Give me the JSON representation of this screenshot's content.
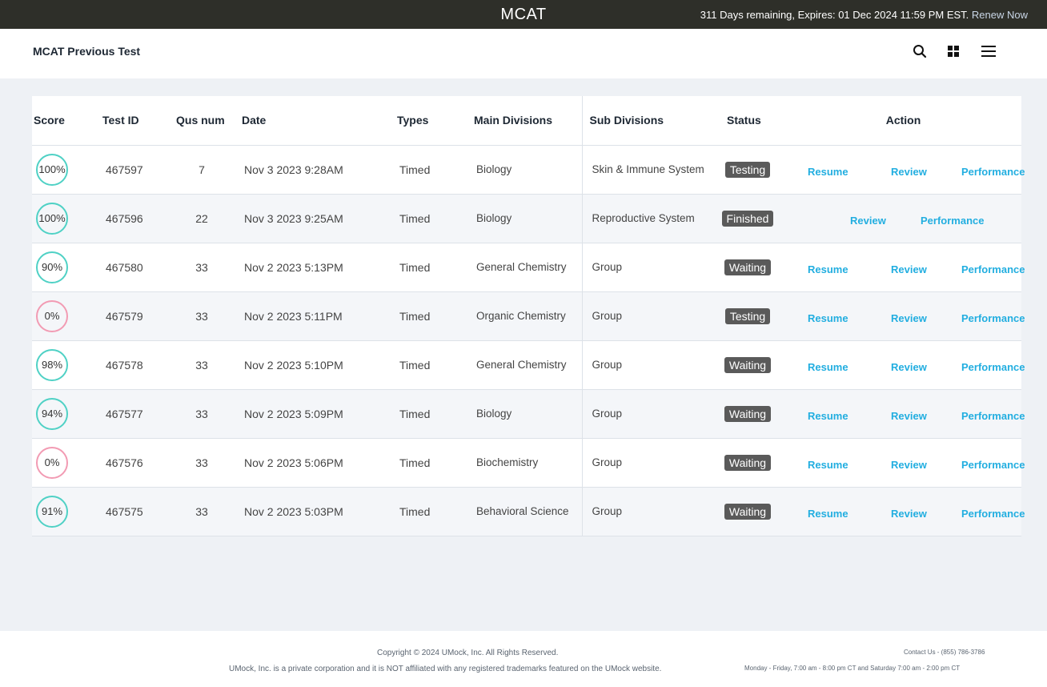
{
  "topbar": {
    "title": "MCAT",
    "subscription": "311 Days remaining, Expires: 01 Dec 2024 11:59 PM EST.",
    "renew_label": "Renew Now"
  },
  "header": {
    "page_title": "MCAT Previous Test",
    "icons": [
      "search-icon",
      "grid-icon",
      "menu-icon"
    ]
  },
  "table": {
    "columns": [
      "Score",
      "Test ID",
      "Qus num",
      "Date",
      "Types",
      "Main Divisions",
      "Sub Divisions",
      "Status",
      "Action"
    ],
    "rows": [
      {
        "score": "100%",
        "score_level": "high",
        "test_id": "467597",
        "qus_num": "7",
        "date": "Nov 3 2023 9:28AM",
        "type": "Timed",
        "main_division": "Biology",
        "sub_division": "Skin & Immune System",
        "status": "Testing",
        "actions": [
          "Resume",
          "Review",
          "Performance"
        ]
      },
      {
        "score": "100%",
        "score_level": "high",
        "test_id": "467596",
        "qus_num": "22",
        "date": "Nov 3 2023 9:25AM",
        "type": "Timed",
        "main_division": "Biology",
        "sub_division": "Reproductive System",
        "status": "Finished",
        "actions": [
          "Review",
          "Performance"
        ]
      },
      {
        "score": "90%",
        "score_level": "high",
        "test_id": "467580",
        "qus_num": "33",
        "date": "Nov 2 2023 5:13PM",
        "type": "Timed",
        "main_division": "General Chemistry",
        "sub_division": "Group",
        "status": "Waiting",
        "actions": [
          "Resume",
          "Review",
          "Performance"
        ]
      },
      {
        "score": "0%",
        "score_level": "low",
        "test_id": "467579",
        "qus_num": "33",
        "date": "Nov 2 2023 5:11PM",
        "type": "Timed",
        "main_division": "Organic Chemistry",
        "sub_division": "Group",
        "status": "Testing",
        "actions": [
          "Resume",
          "Review",
          "Performance"
        ]
      },
      {
        "score": "98%",
        "score_level": "high",
        "test_id": "467578",
        "qus_num": "33",
        "date": "Nov 2 2023 5:10PM",
        "type": "Timed",
        "main_division": "General Chemistry",
        "sub_division": "Group",
        "status": "Waiting",
        "actions": [
          "Resume",
          "Review",
          "Performance"
        ]
      },
      {
        "score": "94%",
        "score_level": "high",
        "test_id": "467577",
        "qus_num": "33",
        "date": "Nov 2 2023 5:09PM",
        "type": "Timed",
        "main_division": "Biology",
        "sub_division": "Group",
        "status": "Waiting",
        "actions": [
          "Resume",
          "Review",
          "Performance"
        ]
      },
      {
        "score": "0%",
        "score_level": "low",
        "test_id": "467576",
        "qus_num": "33",
        "date": "Nov 2 2023 5:06PM",
        "type": "Timed",
        "main_division": "Biochemistry",
        "sub_division": "Group",
        "status": "Waiting",
        "actions": [
          "Resume",
          "Review",
          "Performance"
        ]
      },
      {
        "score": "91%",
        "score_level": "high",
        "test_id": "467575",
        "qus_num": "33",
        "date": "Nov 2 2023 5:03PM",
        "type": "Timed",
        "main_division": "Behavioral Science",
        "sub_division": "Group",
        "status": "Waiting",
        "actions": [
          "Resume",
          "Review",
          "Performance"
        ]
      }
    ]
  },
  "footer": {
    "copyright": "Copyright © 2024 UMock, Inc. All Rights Reserved.",
    "disclaimer": "UMock, Inc. is a private corporation and it is NOT affiliated with any registered trademarks featured on the UMock website.",
    "contact": "Contact Us - (855) 786-3786",
    "hours": "Monday - Friday, 7:00 am - 8:00 pm CT and Saturday 7:00 am - 2:00 pm CT"
  },
  "colors": {
    "topbar_bg": "#2e2f29",
    "score_high": "#4fd1c5",
    "score_low": "#f29bb3",
    "link": "#22aee0",
    "badge_bg": "#5a5a5a"
  }
}
